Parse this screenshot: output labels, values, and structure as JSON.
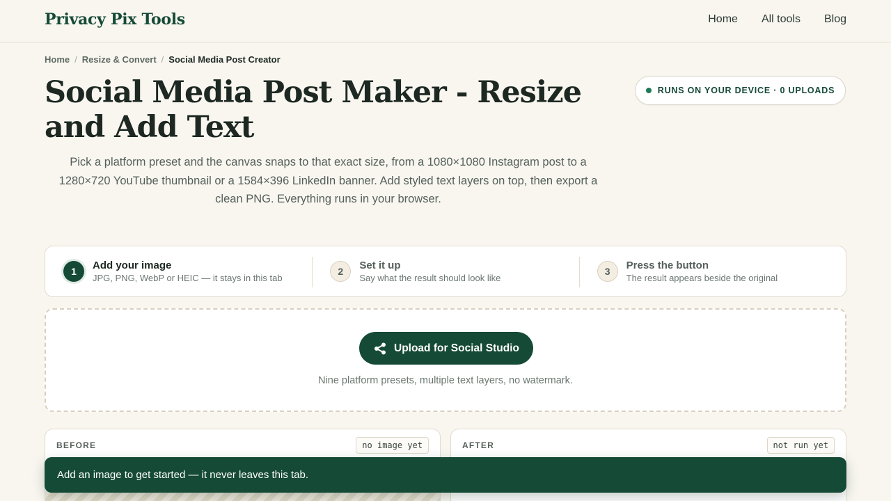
{
  "header": {
    "brand": "Privacy Pix Tools",
    "nav": [
      "Home",
      "All tools",
      "Blog"
    ]
  },
  "breadcrumb": {
    "home": "Home",
    "section": "Resize & Convert",
    "current": "Social Media Post Creator",
    "separator": "/"
  },
  "page": {
    "title": "Social Media Post Maker - Resize and Add Text",
    "subtitle": "Pick a platform preset and the canvas snaps to that exact size, from a 1080×1080 Instagram post to a 1280×720 YouTube thumbnail or a 1584×396 LinkedIn banner. Add styled text layers on top, then export a clean PNG. Everything runs in your browser.",
    "device_badge": "RUNS ON YOUR DEVICE · 0 UPLOADS"
  },
  "steps": [
    {
      "number": "1",
      "title": "Add your image",
      "desc": "JPG, PNG, WebP or HEIC — it stays in this tab"
    },
    {
      "number": "2",
      "title": "Set it up",
      "desc": "Say what the result should look like"
    },
    {
      "number": "3",
      "title": "Press the button",
      "desc": "The result appears beside the original"
    }
  ],
  "dropzone": {
    "button_label": "Upload for Social Studio",
    "button_icon": "share-icon",
    "hint": "Nine platform presets, multiple text layers, no watermark."
  },
  "panels": {
    "before": {
      "label": "BEFORE",
      "badge": "no image yet"
    },
    "after": {
      "label": "AFTER",
      "badge": "not run yet"
    }
  },
  "toast": {
    "message": "Add an image to get started — it never leaves this tab."
  },
  "colors": {
    "brand": "#154a36",
    "background": "#f9f6f0",
    "status_dot": "#1f7a57"
  }
}
